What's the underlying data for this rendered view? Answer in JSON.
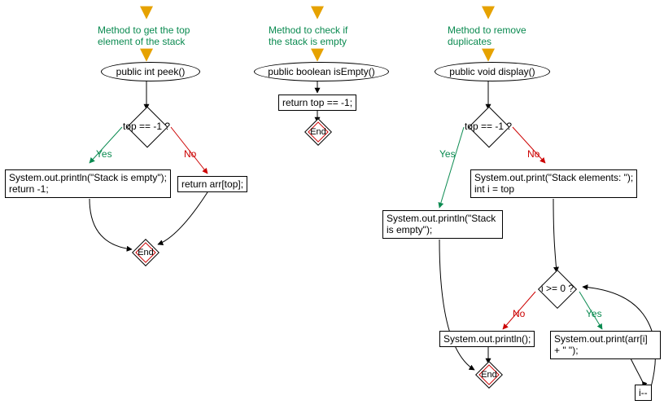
{
  "chart_data": [
    {
      "type": "flowchart",
      "title": "Method to get the top\nelement of the stack",
      "nodes": [
        {
          "id": "c1_start",
          "kind": "terminator",
          "text": "public int peek()"
        },
        {
          "id": "c1_d",
          "kind": "decision",
          "text": "top == -1 ?"
        },
        {
          "id": "c1_yes",
          "kind": "process",
          "text": "System.out.println(\"Stack is empty\");\nreturn -1;"
        },
        {
          "id": "c1_no",
          "kind": "process",
          "text": "return arr[top];"
        },
        {
          "id": "c1_end",
          "kind": "end",
          "text": "End"
        }
      ],
      "edges": [
        {
          "from": "c1_start",
          "to": "c1_d"
        },
        {
          "from": "c1_d",
          "to": "c1_yes",
          "label": "Yes"
        },
        {
          "from": "c1_d",
          "to": "c1_no",
          "label": "No"
        },
        {
          "from": "c1_yes",
          "to": "c1_end"
        },
        {
          "from": "c1_no",
          "to": "c1_end"
        }
      ]
    },
    {
      "type": "flowchart",
      "title": "Method to check if\nthe stack is empty",
      "nodes": [
        {
          "id": "c2_start",
          "kind": "terminator",
          "text": "public boolean isEmpty()"
        },
        {
          "id": "c2_p",
          "kind": "process",
          "text": "return top == -1;"
        },
        {
          "id": "c2_end",
          "kind": "end",
          "text": "End"
        }
      ],
      "edges": [
        {
          "from": "c2_start",
          "to": "c2_p"
        },
        {
          "from": "c2_p",
          "to": "c2_end"
        }
      ]
    },
    {
      "type": "flowchart",
      "title": "Method to remove\nduplicates",
      "nodes": [
        {
          "id": "c3_start",
          "kind": "terminator",
          "text": "public void display()"
        },
        {
          "id": "c3_d1",
          "kind": "decision",
          "text": "top == -1 ?"
        },
        {
          "id": "c3_yes1",
          "kind": "process",
          "text": "System.out.println(\"Stack\nis empty\");"
        },
        {
          "id": "c3_no1",
          "kind": "process",
          "text": "System.out.print(\"Stack elements: \");\nint i = top"
        },
        {
          "id": "c3_d2",
          "kind": "decision",
          "text": "i >= 0 ?"
        },
        {
          "id": "c3_no2",
          "kind": "process",
          "text": "System.out.println();"
        },
        {
          "id": "c3_yes2",
          "kind": "process",
          "text": "System.out.print(arr[i]\n+ \" \");"
        },
        {
          "id": "c3_dec",
          "kind": "process",
          "text": "i--"
        },
        {
          "id": "c3_end",
          "kind": "end",
          "text": "End"
        }
      ],
      "edges": [
        {
          "from": "c3_start",
          "to": "c3_d1"
        },
        {
          "from": "c3_d1",
          "to": "c3_yes1",
          "label": "Yes"
        },
        {
          "from": "c3_d1",
          "to": "c3_no1",
          "label": "No"
        },
        {
          "from": "c3_yes1",
          "to": "c3_end"
        },
        {
          "from": "c3_no1",
          "to": "c3_d2"
        },
        {
          "from": "c3_d2",
          "to": "c3_no2",
          "label": "No"
        },
        {
          "from": "c3_d2",
          "to": "c3_yes2",
          "label": "Yes"
        },
        {
          "from": "c3_yes2",
          "to": "c3_dec"
        },
        {
          "from": "c3_dec",
          "to": "c3_d2"
        },
        {
          "from": "c3_no2",
          "to": "c3_end"
        }
      ]
    }
  ],
  "labels": {
    "yes": "Yes",
    "no": "No"
  },
  "colors": {
    "comment": "#0a8a50",
    "yes": "#0a8a50",
    "no": "#c00000",
    "end_border": "#c00000"
  }
}
